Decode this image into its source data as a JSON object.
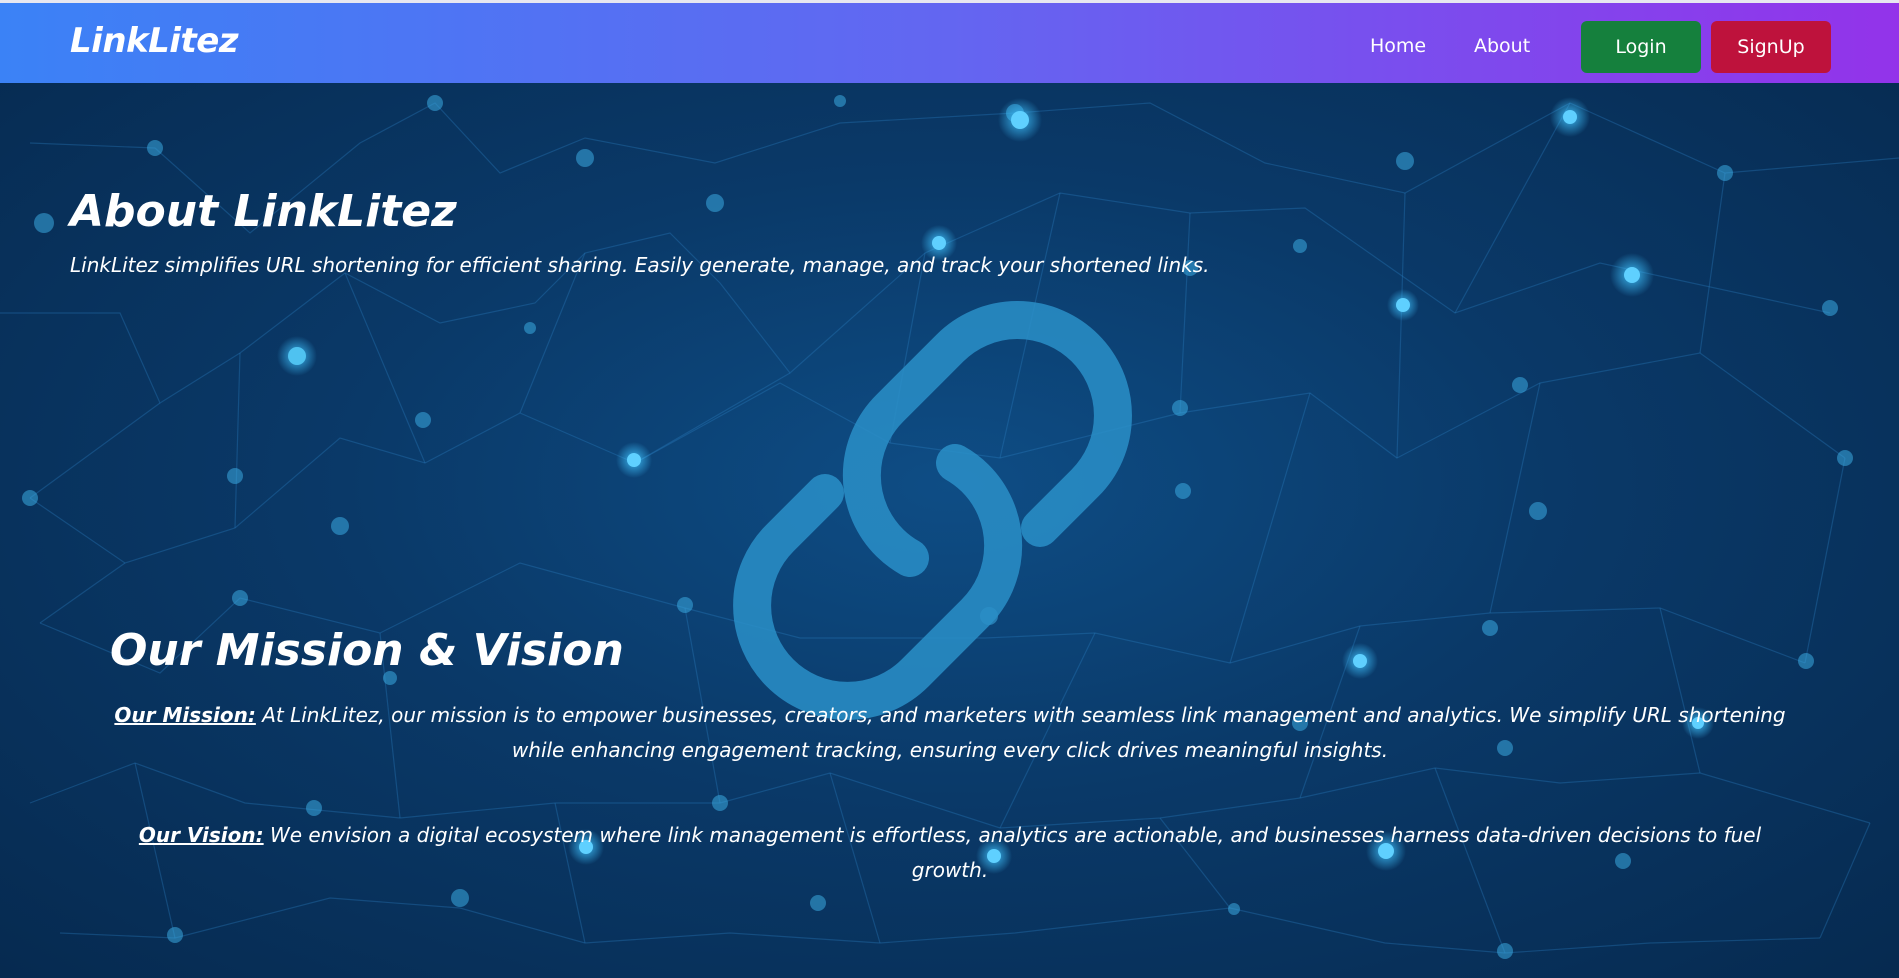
{
  "navbar": {
    "brand": "LinkLitez",
    "links": {
      "home": "Home",
      "about": "About"
    },
    "buttons": {
      "login": "Login",
      "signup": "SignUp"
    },
    "colors": {
      "gradient_start": "#3b82f6",
      "gradient_end": "#9333ea",
      "login": "#15803d",
      "signup": "#be123c"
    }
  },
  "about": {
    "title": "About LinkLitez",
    "text": "LinkLitez simplifies URL shortening for efficient sharing. Easily generate, manage, and track your shortened links."
  },
  "mission_vision": {
    "title": "Our Mission & Vision",
    "mission_label": "Our Mission:",
    "mission_text": " At LinkLitez, our mission is to empower businesses, creators, and marketers with seamless link management and analytics. We simplify URL shortening while enhancing engagement tracking, ensuring every click drives meaningful insights.",
    "vision_label": "Our Vision:",
    "vision_text": " We envision a digital ecosystem where link management is effortless, analytics are actionable, and businesses harness data-driven decisions to fuel growth."
  },
  "background": {
    "icon": "chain-link-icon",
    "pattern": "network-nodes"
  }
}
